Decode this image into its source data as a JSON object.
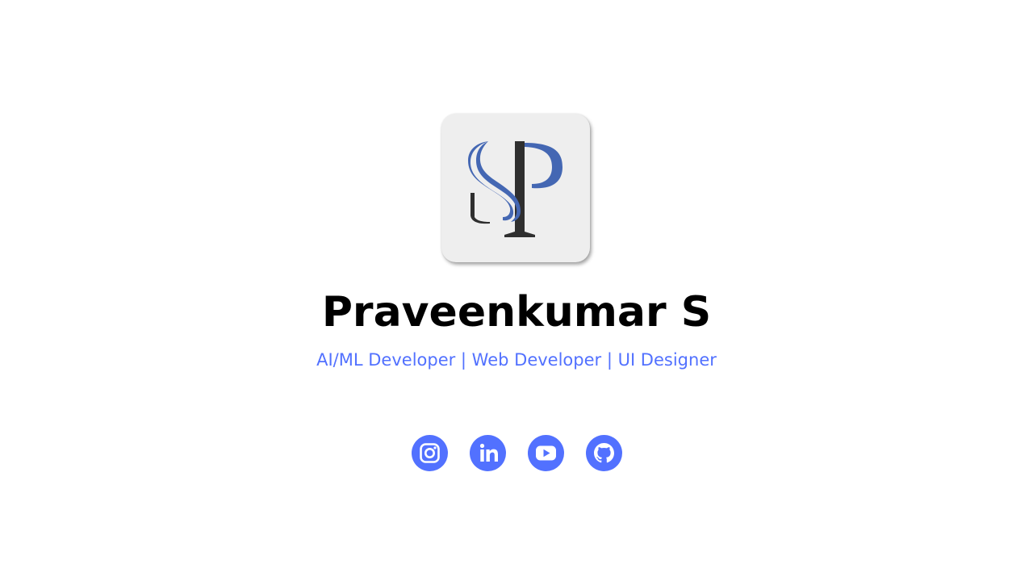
{
  "profile": {
    "logo": {
      "monogram": "SP",
      "colors": {
        "s": "#4467b3",
        "p": "#4467b3",
        "stem": "#2f2f2f",
        "card": "#eeeeee"
      }
    },
    "name": "Praveenkumar S",
    "tagline": "AI/ML Developer | Web Developer | UI Designer"
  },
  "social": {
    "accent": "#5271ff",
    "links": [
      {
        "icon": "instagram-icon"
      },
      {
        "icon": "linkedin-icon"
      },
      {
        "icon": "youtube-icon"
      },
      {
        "icon": "github-icon"
      }
    ]
  }
}
